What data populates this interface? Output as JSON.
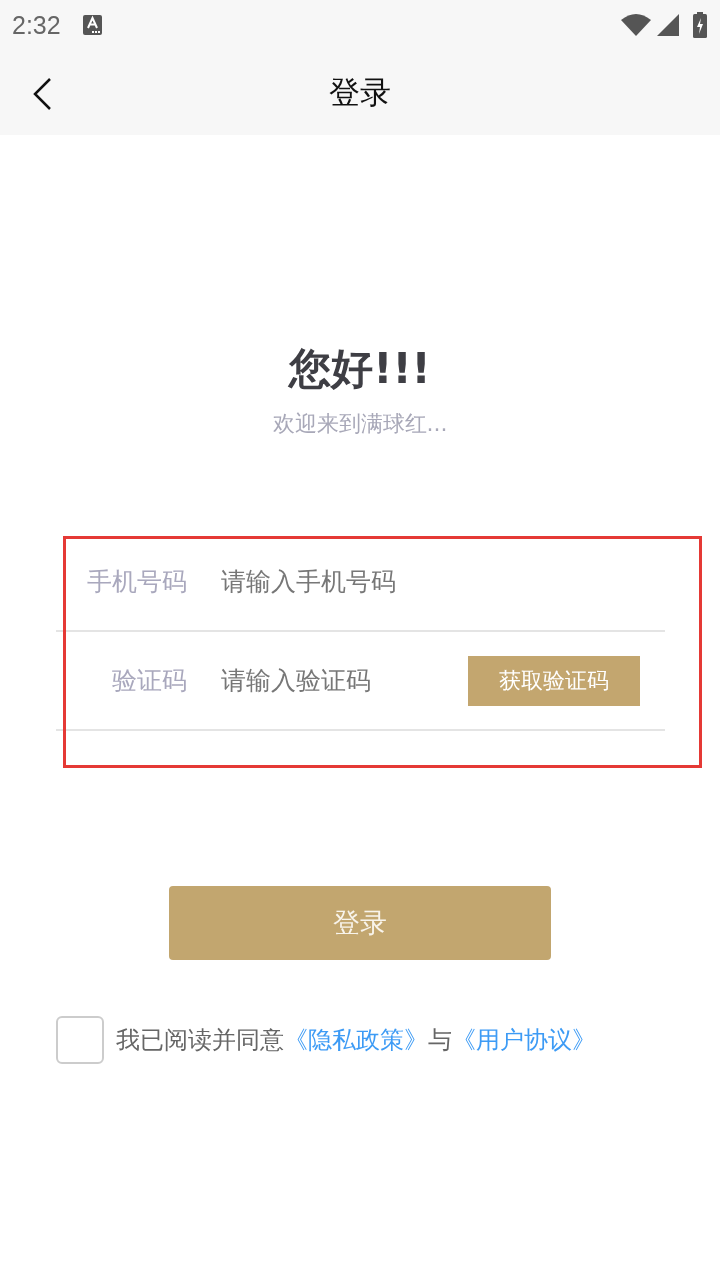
{
  "status_bar": {
    "time": "2:32"
  },
  "header": {
    "title": "登录"
  },
  "greeting": {
    "title": "您好!!!",
    "subtitle": "欢迎来到满球红..."
  },
  "form": {
    "highlighted": true,
    "fields": [
      {
        "kind": "text",
        "label": "手机号码",
        "placeholder": "请输入手机号码"
      },
      {
        "kind": "code",
        "label": "验证码",
        "placeholder": "请输入验证码",
        "action": "获取验证码"
      }
    ]
  },
  "login_button": "登录",
  "agreement": {
    "checked": false,
    "parts": [
      {
        "kind": "text",
        "text": "我已阅读并同意"
      },
      {
        "kind": "link",
        "text": "《隐私政策》"
      },
      {
        "kind": "text",
        "text": "与"
      },
      {
        "kind": "link",
        "text": "《用户协议》"
      }
    ]
  }
}
